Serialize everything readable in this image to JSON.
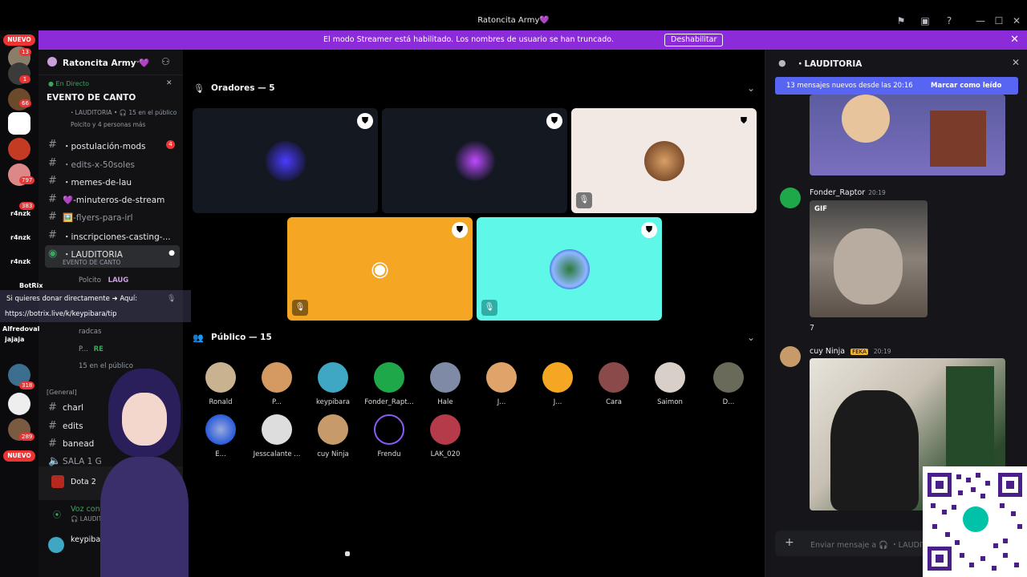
{
  "window": {
    "title": "Ratoncita Army💜"
  },
  "banner": {
    "text": "El modo Streamer está habilitado. Los nombres de usuario se han truncado.",
    "button": "Deshabilitar"
  },
  "guilds": {
    "nuevo_top": "NUEVO",
    "nuevo_bottom": "NUEVO",
    "badges": [
      "13",
      "1",
      "66",
      "797",
      "383",
      "318",
      "289"
    ]
  },
  "server": {
    "name": "Ratoncita Army 💜",
    "event": {
      "live_label": "En Directo",
      "title": "EVENTO DE CANTO",
      "location": "・LAUDITORIA • 🎧 15 en el público",
      "participants": "Polcito y 4 personas más"
    },
    "channels": [
      {
        "name": "・postulación-mods",
        "badge": "4"
      },
      {
        "name": "・edits-x-50soles"
      },
      {
        "name": "・memes-de-lau"
      },
      {
        "name": "💜-minuteros-de-stream"
      },
      {
        "name": "🖼️-flyers-para-irl"
      },
      {
        "name": "・inscripciones-casting-..."
      }
    ],
    "stage_channel": {
      "name": "・LAUDITORIA",
      "sub": "EVENTO DE CANTO"
    },
    "stage_users": [
      "Polcito",
      "radcas",
      "P...",
      "15 en el público"
    ],
    "stage_user_tag": "LAUG",
    "stage_user_tag2": "RE",
    "category_general": "[General]",
    "lower_channels": [
      "charl",
      "edits",
      "banead",
      "SALA 1 G"
    ]
  },
  "user_panel": {
    "activity": "Dota 2",
    "voice_status": "Voz conectada",
    "voice_location": "🎧 LAUDITORIA / R...",
    "username": "keypibara"
  },
  "stage": {
    "speakers_label": "Oradores — 5",
    "audience_label": "Público — 15",
    "audience": [
      "Ronald",
      "P...",
      "keypibara",
      "Fonder_Rapt...",
      "Hale",
      "J...",
      "J...",
      "Cara",
      "Saimon",
      "D...",
      "E...",
      "Jesscalante ...",
      "cuy Ninja",
      "Frendu",
      "LAK_020"
    ]
  },
  "chat": {
    "header": "・LAUDITORIA",
    "new_messages": "13 mensajes nuevos desde las 20:16",
    "mark_read": "Marcar como leído",
    "messages": [
      {
        "author": "Fonder_Raptor",
        "time": "20:19",
        "gif_label": "GIF",
        "text": "7"
      },
      {
        "author": "cuy Ninja",
        "tag": "FEKA",
        "time": "20:19"
      }
    ],
    "composer_placeholder": "Enviar mensaje a 🎧 ・LAUDIT"
  },
  "overlay": {
    "donation_line1": "Si quieres donar directamente ➜ Aquí:",
    "donation_line2": "https://botrix.live/k/keypibara/tip",
    "chat_names": [
      "r4nzk",
      "r4nzk",
      "r4nzk",
      "BotRix",
      "Alfredoval",
      "jajaja"
    ]
  },
  "colors": {
    "accent": "#5865f2",
    "banner": "#8b2bd9",
    "live": "#3ba55d",
    "tile_orange": "#f5a623",
    "tile_cyan": "#5ef7e8",
    "tile_cream": "#f2e8e4"
  }
}
